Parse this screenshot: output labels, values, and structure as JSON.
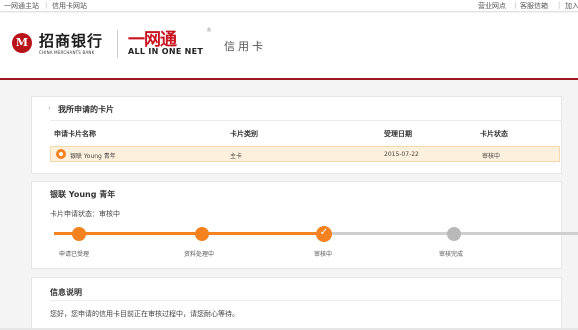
{
  "topbar": {
    "left_links": [
      "一网通主站",
      "信用卡网站"
    ],
    "right_links": [
      "营业网点",
      "客服信箱",
      "加入收藏"
    ]
  },
  "header": {
    "logo_glyph": "M",
    "bank_name_cn": "招商银行",
    "bank_name_en": "CHINA MERCHANTS BANK",
    "aion_cn": "一网通",
    "aion_reg": "®",
    "aion_en": "ALL IN ONE NET",
    "section": "信用卡",
    "brand_color": "#b8121b"
  },
  "applications": {
    "title": "我所申请的卡片",
    "columns": [
      "申请卡片名称",
      "卡片类别",
      "受理日期",
      "卡片状态"
    ],
    "rows": [
      {
        "name": "银联 Young 青年",
        "category": "主卡",
        "date": "2015-07-22",
        "status": "审核中",
        "selected": true
      }
    ],
    "highlight_color": "#fdf1dd"
  },
  "progress": {
    "card_name": "银联 Young 青年",
    "status_line": "卡片申请状态：审核中",
    "steps": [
      {
        "label": "申请已受理",
        "state": "done"
      },
      {
        "label": "资料处理中",
        "state": "done"
      },
      {
        "label": "审核中",
        "state": "current"
      },
      {
        "label": "审核完成",
        "state": "pending"
      }
    ],
    "accent_color": "#f58220",
    "inactive_color": "#cfcfcf"
  },
  "info": {
    "title": "信息说明",
    "message": "您好，您申请的信用卡目前正在审核过程中，请您耐心等待。"
  }
}
